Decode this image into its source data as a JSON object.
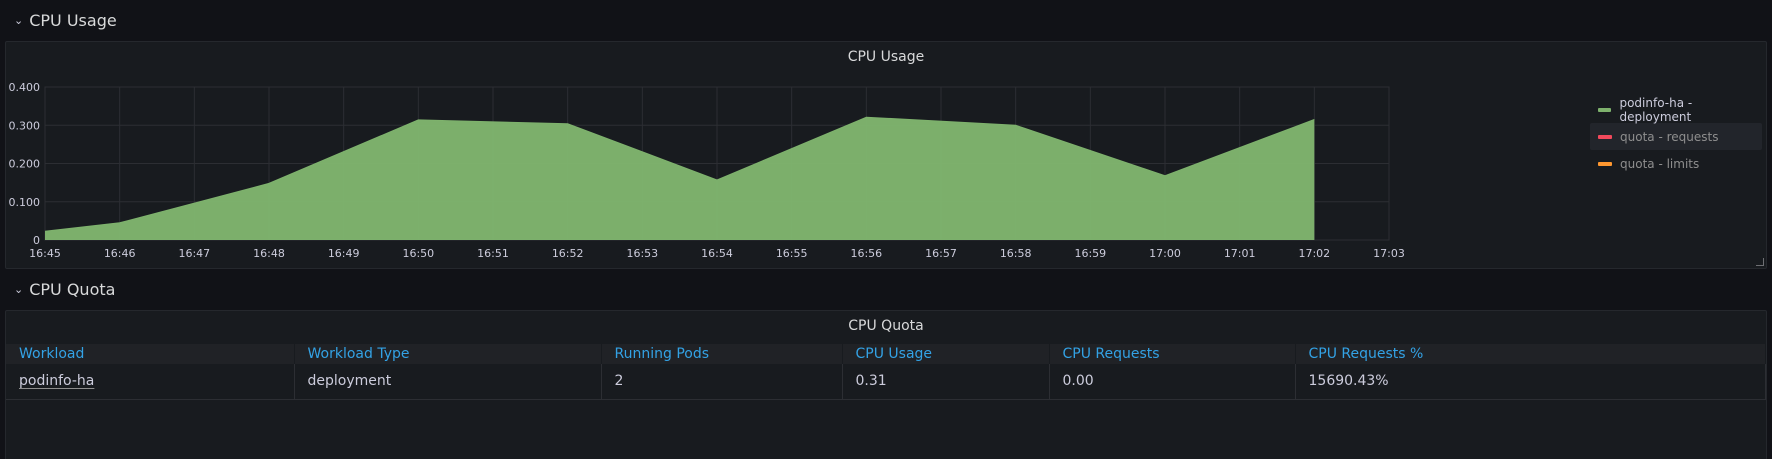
{
  "rows": {
    "cpu_usage": {
      "title": "CPU Usage"
    },
    "cpu_quota": {
      "title": "CPU Quota"
    }
  },
  "usage_panel": {
    "title": "CPU Usage"
  },
  "quota_panel": {
    "title": "CPU Quota"
  },
  "icons": {
    "row_toggle": "chevron-down-icon",
    "resize": "resize-handle-icon"
  },
  "colors": {
    "series_deployment": "#7eb26d",
    "series_requests": "#f2495c",
    "series_limits": "#ff9830",
    "table_header": "#33a2e5"
  },
  "chart_data": {
    "type": "area",
    "title": "CPU Usage",
    "x": [
      "16:45",
      "16:46",
      "16:47",
      "16:48",
      "16:49",
      "16:50",
      "16:51",
      "16:52",
      "16:53",
      "16:54",
      "16:55",
      "16:56",
      "16:57",
      "16:58",
      "16:59",
      "17:00",
      "17:01",
      "17:02",
      "17:03"
    ],
    "x_ticks": [
      "16:45",
      "16:46",
      "16:47",
      "16:48",
      "16:49",
      "16:50",
      "16:51",
      "16:52",
      "16:53",
      "16:54",
      "16:55",
      "16:56",
      "16:57",
      "16:58",
      "16:59",
      "17:00",
      "17:01",
      "17:02",
      "17:03"
    ],
    "y_ticks": [
      "0",
      "0.100",
      "0.200",
      "0.300",
      "0.400"
    ],
    "y_tick_values": [
      0,
      0.1,
      0.2,
      0.3,
      0.4
    ],
    "ylim": [
      0,
      0.4
    ],
    "grid": true,
    "legend_placement": "right",
    "series": [
      {
        "name": "podinfo-ha - deployment",
        "color": "#7eb26d",
        "points": [
          [
            "16:45",
            0.023
          ],
          [
            "16:46",
            0.045
          ],
          [
            "16:48",
            0.148
          ],
          [
            "16:50",
            0.314
          ],
          [
            "16:52",
            0.304
          ],
          [
            "16:54",
            0.157
          ],
          [
            "16:56",
            0.321
          ],
          [
            "16:58",
            0.3
          ],
          [
            "17:00",
            0.168
          ],
          [
            "17:02",
            0.315
          ]
        ]
      },
      {
        "name": "quota - requests",
        "color": "#f2495c",
        "points": []
      },
      {
        "name": "quota - limits",
        "color": "#ff9830",
        "points": []
      }
    ]
  },
  "table": {
    "columns": [
      "Workload",
      "Workload Type",
      "Running Pods",
      "CPU Usage",
      "CPU Requests",
      "CPU Requests %"
    ],
    "rows": [
      [
        "podinfo-ha",
        "deployment",
        "2",
        "0.31",
        "0.00",
        "15690.43%"
      ]
    ]
  }
}
